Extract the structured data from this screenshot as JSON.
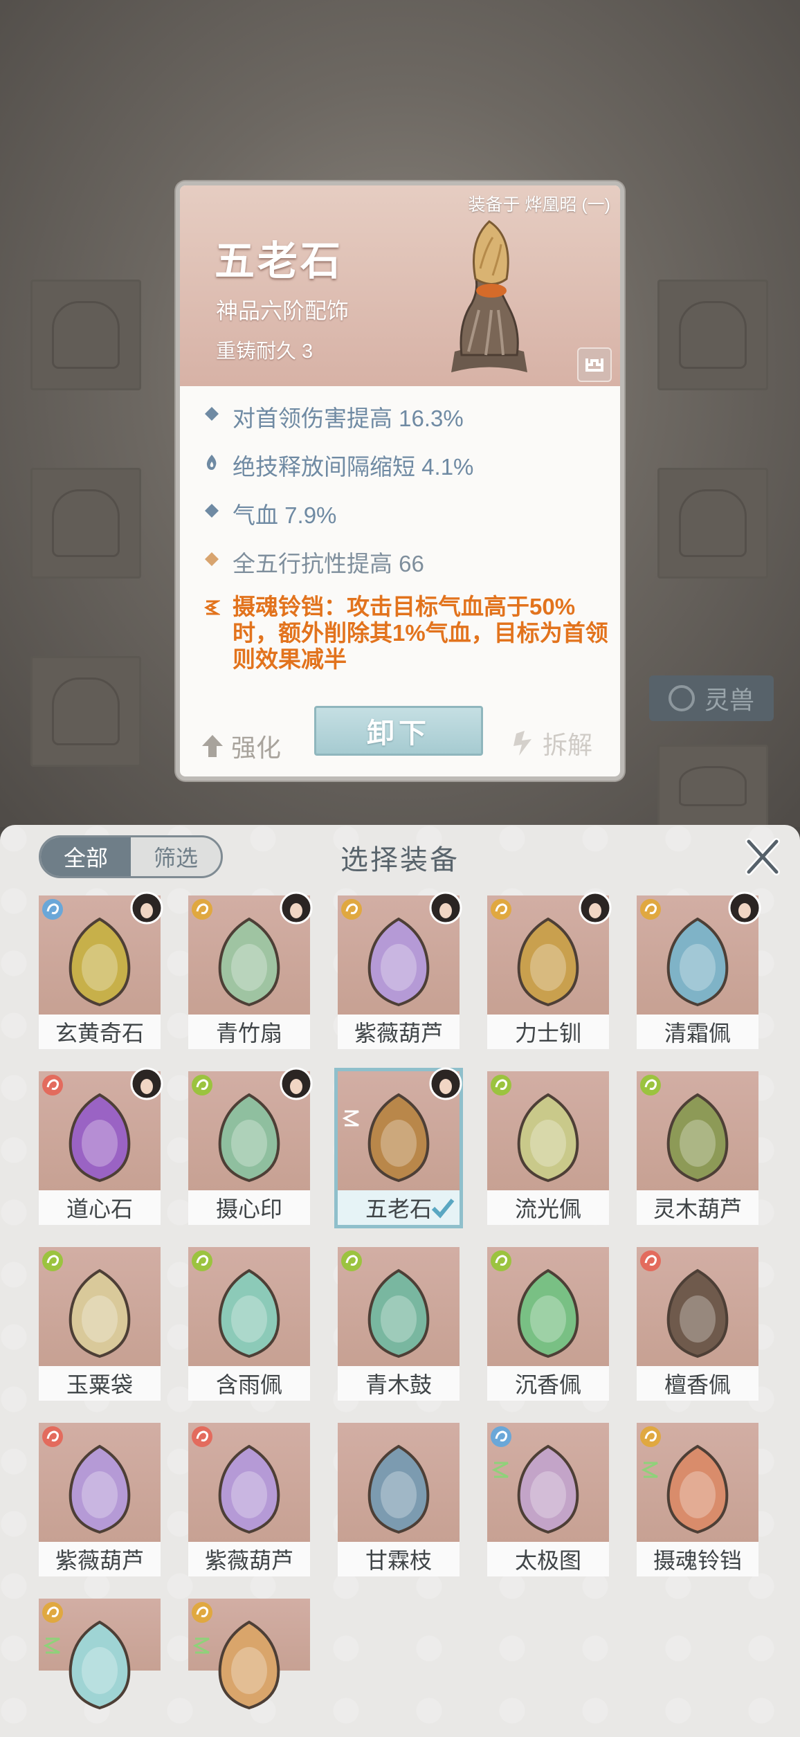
{
  "detail": {
    "equipped_by": "装备于 烨凰昭 (一)",
    "name": "五老石",
    "grade": "神品六阶配饰",
    "durability": "重铸耐久 3",
    "stats": [
      {
        "icon": "diamond-bullet-icon",
        "text": "对首领伤害提高 16.3%"
      },
      {
        "icon": "flame-bullet-icon",
        "text": "绝技释放间隔缩短 4.1%"
      },
      {
        "icon": "diamond-bullet-icon",
        "text": "气血 7.9%"
      },
      {
        "icon": "orange-diamond-bullet-icon",
        "text": "全五行抗性提高 66"
      },
      {
        "icon": "rune-bullet-icon",
        "text": "摄魂铃铛：攻击目标气血高于50%时，额外削除其1%气血，目标为首领则效果减半"
      }
    ],
    "enhance_label": "强化",
    "unequip_label": "卸下",
    "dismantle_label": "拆解"
  },
  "background": {
    "tab_label": "灵兽"
  },
  "panel": {
    "tabs": [
      "全部",
      "筛选"
    ],
    "active_tab": "全部",
    "title": "选择装备",
    "items": [
      {
        "name": "玄黄奇石",
        "element": "water",
        "portrait": true,
        "color": "#c7b04a"
      },
      {
        "name": "青竹扇",
        "element": "metal",
        "portrait": true,
        "color": "#9fc4a2"
      },
      {
        "name": "紫薇葫芦",
        "element": "metal",
        "portrait": true,
        "color": "#b59ad6"
      },
      {
        "name": "力士钏",
        "element": "metal",
        "portrait": true,
        "color": "#c9a04e"
      },
      {
        "name": "清霜佩",
        "element": "metal",
        "portrait": true,
        "color": "#7fb3c7"
      },
      {
        "name": "道心石",
        "element": "fire",
        "portrait": true,
        "color": "#9a63c4"
      },
      {
        "name": "摄心印",
        "element": "wood",
        "portrait": true,
        "color": "#8fbf9f"
      },
      {
        "name": "五老石",
        "element": "",
        "portrait": true,
        "color": "#b9874a",
        "selected": true,
        "mark": true
      },
      {
        "name": "流光佩",
        "element": "wood",
        "portrait": false,
        "color": "#c9c98a"
      },
      {
        "name": "灵木葫芦",
        "element": "wood",
        "portrait": false,
        "color": "#8d9a57"
      },
      {
        "name": "玉粟袋",
        "element": "wood",
        "portrait": false,
        "color": "#d9c99a"
      },
      {
        "name": "含雨佩",
        "element": "wood",
        "portrait": false,
        "color": "#8ccab8"
      },
      {
        "name": "青木鼓",
        "element": "wood",
        "portrait": false,
        "color": "#79b7a0"
      },
      {
        "name": "沉香佩",
        "element": "wood",
        "portrait": false,
        "color": "#79c084"
      },
      {
        "name": "檀香佩",
        "element": "fire",
        "portrait": false,
        "color": "#6f5a4c"
      },
      {
        "name": "紫薇葫芦",
        "element": "fire",
        "portrait": false,
        "color": "#b59ad6"
      },
      {
        "name": "紫薇葫芦",
        "element": "fire",
        "portrait": false,
        "color": "#b59ad6"
      },
      {
        "name": "甘霖枝",
        "element": "",
        "portrait": false,
        "color": "#7c9bb0"
      },
      {
        "name": "太极图",
        "element": "water",
        "portrait": false,
        "color": "#c3a4c8",
        "mark": true
      },
      {
        "name": "摄魂铃铛",
        "element": "metal",
        "portrait": false,
        "color": "#d98c6b",
        "mark": true
      },
      {
        "name": "",
        "element": "metal",
        "portrait": false,
        "color": "#9fd4d4",
        "mark": true
      },
      {
        "name": "",
        "element": "metal",
        "portrait": false,
        "color": "#d9a56b",
        "mark": true
      }
    ]
  }
}
